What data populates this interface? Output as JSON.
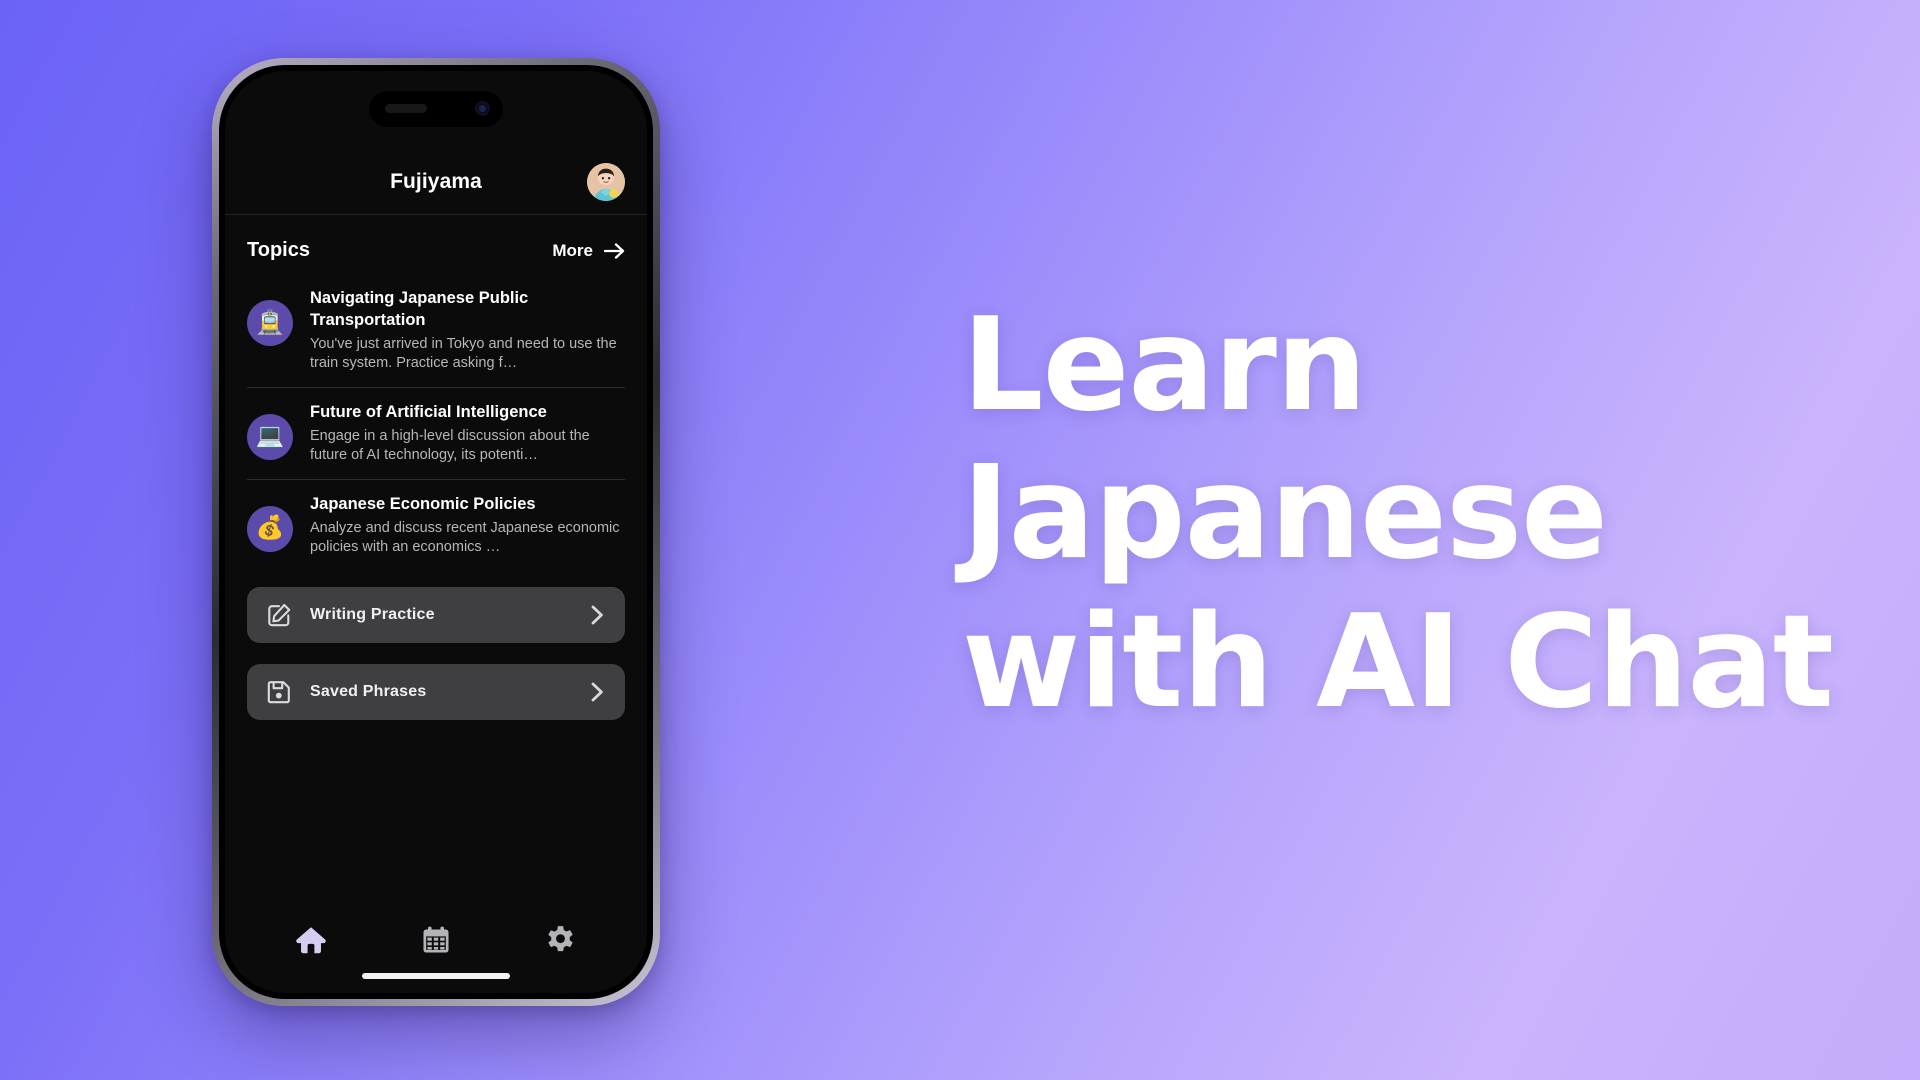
{
  "background": {
    "gradient_from": "#6b63f6",
    "gradient_to": "#c9b3fd"
  },
  "marketing": {
    "line1": "Learn",
    "line2": "Japanese",
    "line3": "with AI Chat",
    "color": "#ffffff"
  },
  "app": {
    "title": "Fujiyama",
    "avatar_icon": "user-avatar-icon",
    "accent_color": "#5c4bab",
    "screen_background": "#0b0b0c"
  },
  "topics": {
    "section_label": "Topics",
    "more_label": "More",
    "more_icon": "arrow-right-icon",
    "items": [
      {
        "emoji": "🚊",
        "emoji_name": "tram-icon",
        "title": "Navigating Japanese Public Transportation",
        "description": "You've just arrived in Tokyo and need to use the train system. Practice asking f…"
      },
      {
        "emoji": "💻",
        "emoji_name": "laptop-icon",
        "title": "Future of Artificial Intelligence",
        "description": "Engage in a high-level discussion about the future of AI technology, its potenti…"
      },
      {
        "emoji": "💰",
        "emoji_name": "money-bag-icon",
        "title": "Japanese Economic Policies",
        "description": "Analyze and discuss recent Japanese economic policies with an economics …"
      }
    ]
  },
  "actions": [
    {
      "label": "Writing Practice",
      "icon": "pencil-square-icon",
      "chevron": "chevron-right-icon"
    },
    {
      "label": "Saved Phrases",
      "icon": "floppy-disk-save-icon",
      "chevron": "chevron-right-icon"
    }
  ],
  "tabbar": {
    "items": [
      {
        "icon": "home-icon",
        "active": true,
        "color": "#d6cdf0"
      },
      {
        "icon": "calendar-icon",
        "active": false,
        "color": "#b4b4b8"
      },
      {
        "icon": "gear-icon",
        "active": false,
        "color": "#b4b4b8"
      }
    ]
  }
}
